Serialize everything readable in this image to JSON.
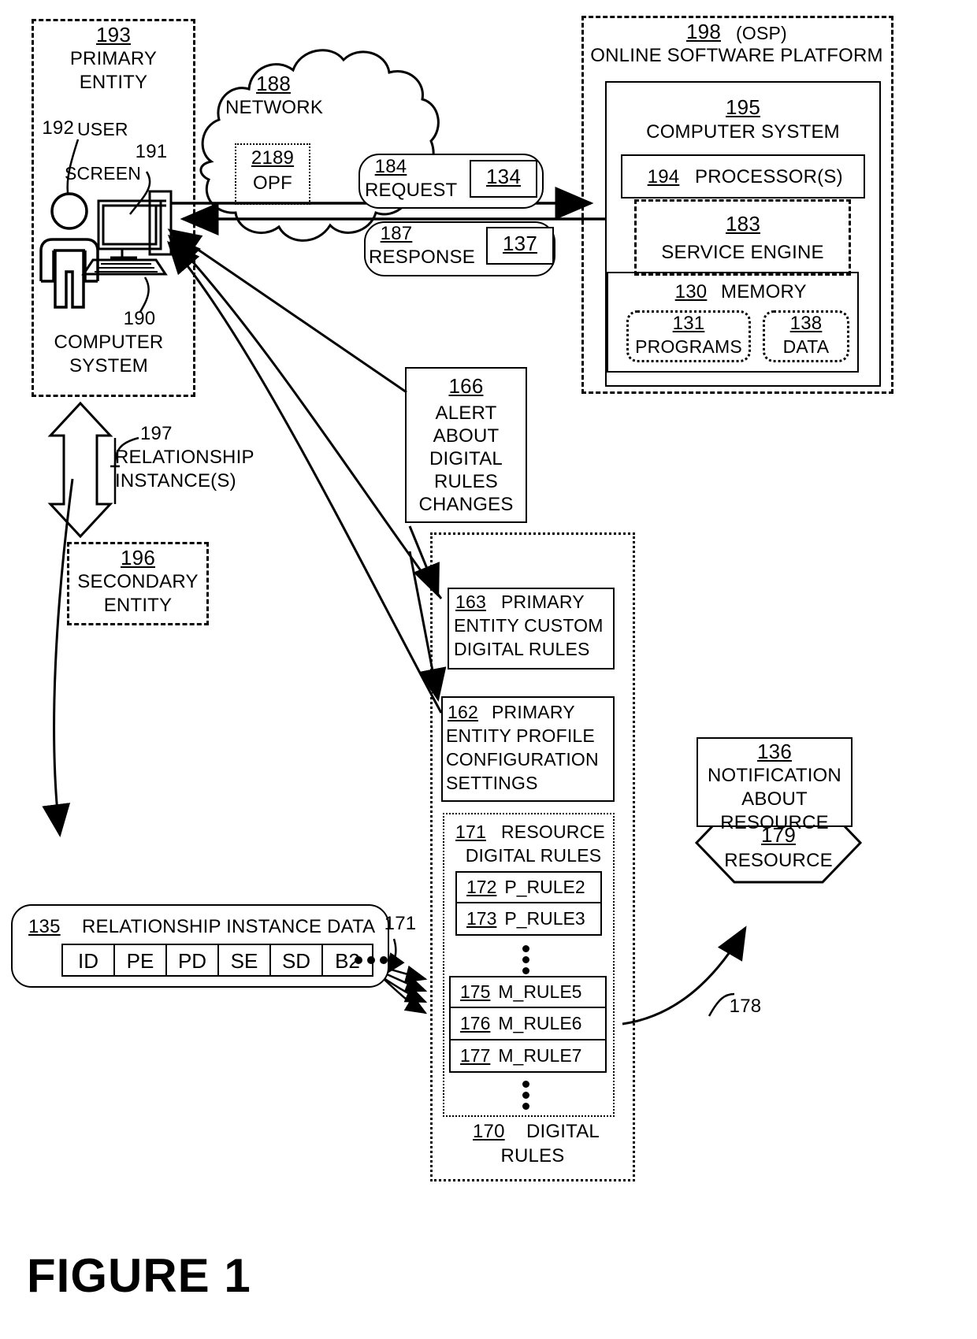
{
  "figure": {
    "caption": "FIGURE 1"
  },
  "primary_entity": {
    "ref": "193",
    "line1": "PRIMARY",
    "line2": "ENTITY",
    "user": {
      "ref": "192",
      "label": "USER"
    },
    "screen": {
      "ref": "191",
      "label": "SCREEN"
    },
    "computer_system": {
      "ref": "190",
      "line1": "COMPUTER",
      "line2": "SYSTEM"
    }
  },
  "network": {
    "ref": "188",
    "label": "NETWORK",
    "opf": {
      "ref": "2189",
      "label": "OPF"
    }
  },
  "request": {
    "ref": "184",
    "label": "REQUEST",
    "payload_ref": "134"
  },
  "response": {
    "ref": "187",
    "label": "RESPONSE",
    "payload_ref": "137"
  },
  "osp": {
    "ref": "198",
    "abbrev": "(OSP)",
    "title": "ONLINE SOFTWARE PLATFORM",
    "computer_system": {
      "ref": "195",
      "label": "COMPUTER SYSTEM"
    },
    "processors": {
      "ref": "194",
      "label": "PROCESSOR(S)"
    },
    "service_engine": {
      "ref": "183",
      "label": "SERVICE ENGINE"
    },
    "memory": {
      "ref": "130",
      "label": "MEMORY"
    },
    "programs": {
      "ref": "131",
      "label": "PROGRAMS"
    },
    "data": {
      "ref": "138",
      "label": "DATA"
    }
  },
  "relationship_instances": {
    "ref": "197",
    "line1": "RELATIONSHIP",
    "line2": "INSTANCE(S)"
  },
  "secondary_entity": {
    "ref": "196",
    "line1": "SECONDARY",
    "line2": "ENTITY"
  },
  "alert": {
    "ref": "166",
    "lines": [
      "ALERT",
      "ABOUT",
      "DIGITAL",
      "RULES",
      "CHANGES"
    ]
  },
  "relationship_instance_data": {
    "ref": "135",
    "label": "RELATIONSHIP INSTANCE DATA",
    "columns": [
      "ID",
      "PE",
      "PD",
      "SE",
      "SD",
      "B2"
    ],
    "more": "•••"
  },
  "digital_rules": {
    "ref": "170",
    "line1": "DIGITAL",
    "line2": "RULES",
    "custom_rules": {
      "ref": "163",
      "lines": [
        "PRIMARY",
        "ENTITY CUSTOM",
        "DIGITAL RULES"
      ]
    },
    "profile_settings": {
      "ref": "162",
      "lines": [
        "PRIMARY",
        "ENTITY PROFILE",
        "CONFIGURATION",
        "SETTINGS"
      ]
    },
    "resource_rules": {
      "ref": "171",
      "line1": "RESOURCE",
      "line2": "DIGITAL RULES",
      "pointer_ref": "171",
      "rules_top": [
        {
          "ref": "172",
          "name": "P_RULE2"
        },
        {
          "ref": "173",
          "name": "P_RULE3"
        }
      ],
      "rules_bottom": [
        {
          "ref": "175",
          "name": "M_RULE5"
        },
        {
          "ref": "176",
          "name": "M_RULE6"
        },
        {
          "ref": "177",
          "name": "M_RULE7"
        }
      ]
    }
  },
  "notification": {
    "ref": "136",
    "lines": [
      "NOTIFICATION",
      "ABOUT",
      "RESOURCE"
    ]
  },
  "resource": {
    "ref": "179",
    "label": "RESOURCE",
    "arrow_ref": "178"
  }
}
